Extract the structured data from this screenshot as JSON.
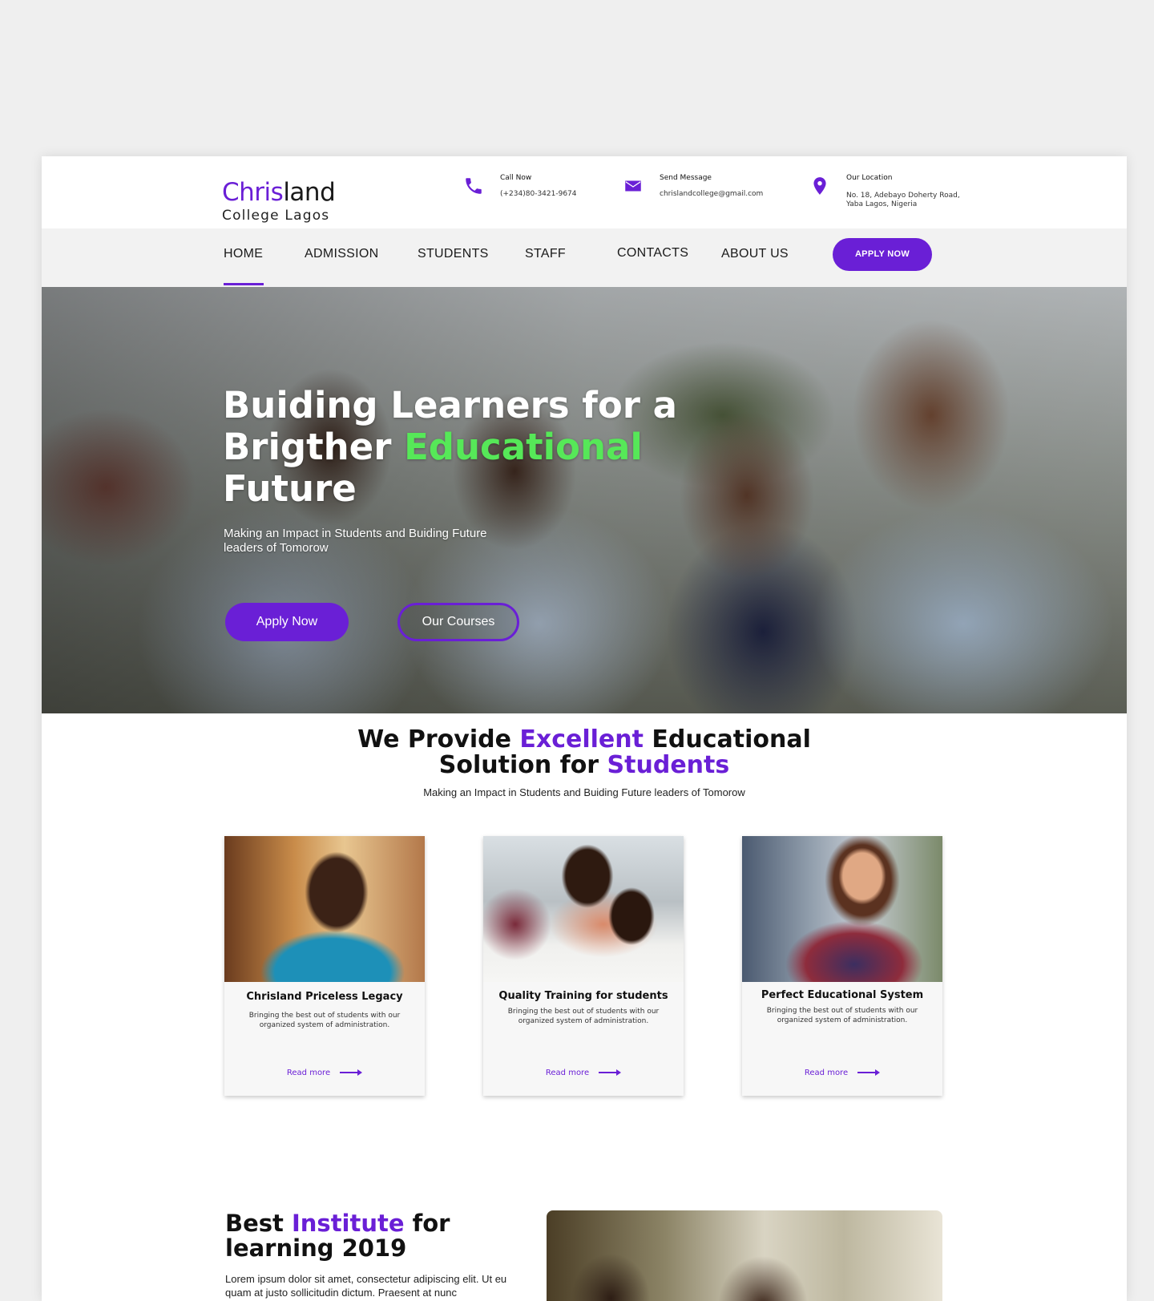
{
  "brand": {
    "name_accent": "Chris",
    "name_rest": "land",
    "subtitle": "College Lagos",
    "accent_color": "#6a1fd6"
  },
  "contacts": [
    {
      "icon": "phone-icon",
      "label": "Call Now",
      "value": "(+234)80-3421-9674"
    },
    {
      "icon": "mail-icon",
      "label": "Send Message",
      "value": "chrislandcollege@gmail.com"
    },
    {
      "icon": "location-pin-icon",
      "label": "Our Location",
      "value_line1": "No. 18, Adebayo Doherty Road,",
      "value_line2": "Yaba Lagos, Nigeria"
    }
  ],
  "nav": {
    "items": [
      "HOME",
      "ADMISSION",
      "STUDENTS",
      "STAFF",
      "CONTACTS",
      "ABOUT US"
    ],
    "active": "HOME",
    "apply_label": "APPLY NOW"
  },
  "hero": {
    "title_part1": "Buiding Learners for a",
    "title_part2": "Brigther ",
    "title_highlight": "Educational",
    "title_part3": "Future",
    "subtitle": "Making an Impact in Students and Buiding Future leaders of Tomorow",
    "apply_label": "Apply Now",
    "courses_label": "Our Courses",
    "highlight_color": "#56e858"
  },
  "provide": {
    "t1": "We Provide ",
    "t2": "Excellent",
    "t3": " Educational",
    "t4": "Solution for ",
    "t5": "Students",
    "subtitle": "Making an Impact in Students and Buiding Future leaders of Tomorow"
  },
  "cards": [
    {
      "title": "Chrisland Priceless Legacy",
      "desc": "Bringing the best out of students with our organized system of administration.",
      "link": "Read more"
    },
    {
      "title": "Quality Training for students",
      "desc": "Bringing the best out of students with our organized system of administration.",
      "link": "Read more"
    },
    {
      "title": "Perfect Educational System",
      "desc": "Bringing the best out of students with our organized system of administration.",
      "link": "Read more"
    }
  ],
  "best": {
    "t1": "Best ",
    "t2": "Institute",
    "t3": " for learning 2019",
    "text": "Lorem ipsum dolor sit amet, consectetur adipiscing elit. Ut eu quam at justo sollicitudin dictum. Praesent at nunc"
  }
}
